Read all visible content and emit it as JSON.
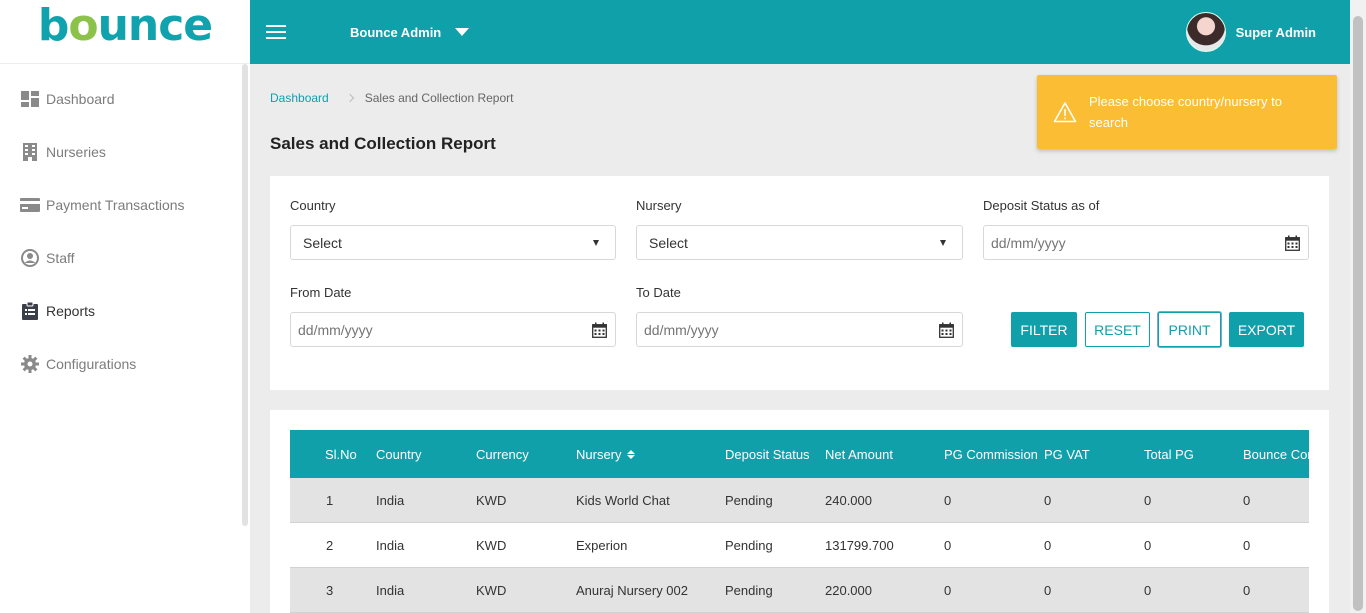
{
  "brand": {
    "logo_pre": "b",
    "logo_dot": "o",
    "logo_post": "unce",
    "primary_color": "#0fa0aa",
    "warning_color": "#fbbd33"
  },
  "sidebar": {
    "items": [
      {
        "label": "Dashboard",
        "icon": "dashboard-icon"
      },
      {
        "label": "Nurseries",
        "icon": "building-icon"
      },
      {
        "label": "Payment Transactions",
        "icon": "credit-card-icon"
      },
      {
        "label": "Staff",
        "icon": "user-icon"
      },
      {
        "label": "Reports",
        "icon": "clipboard-icon",
        "active": true
      },
      {
        "label": "Configurations",
        "icon": "gear-icon"
      }
    ]
  },
  "header": {
    "org_name": "Bounce Admin",
    "user_name": "Super Admin"
  },
  "breadcrumb": {
    "home": "Dashboard",
    "current": "Sales and Collection Report"
  },
  "page": {
    "title": "Sales and Collection Report"
  },
  "toast": {
    "message": "Please choose country/nursery to search",
    "line1": "Please choose country/nursery to",
    "line2": "search"
  },
  "filters": {
    "country": {
      "label": "Country",
      "value": "Select"
    },
    "nursery": {
      "label": "Nursery",
      "value": "Select"
    },
    "deposit_status_as_of": {
      "label": "Deposit Status as of",
      "placeholder": "dd/mm/yyyy"
    },
    "from_date": {
      "label": "From Date",
      "placeholder": "dd/mm/yyyy"
    },
    "to_date": {
      "label": "To Date",
      "placeholder": "dd/mm/yyyy"
    },
    "buttons": {
      "filter": "FILTER",
      "reset": "RESET",
      "print": "PRINT",
      "export": "EXPORT"
    }
  },
  "table": {
    "columns": [
      "Sl.No",
      "Country",
      "Currency",
      "Nursery",
      "Deposit Status",
      "Net Amount",
      "PG Commission",
      "PG VAT",
      "Total PG",
      "Bounce Com"
    ],
    "rows": [
      [
        "1",
        "India",
        "KWD",
        "Kids World Chat",
        "Pending",
        "240.000",
        "0",
        "0",
        "0",
        "0"
      ],
      [
        "2",
        "India",
        "KWD",
        "Experion",
        "Pending",
        "131799.700",
        "0",
        "0",
        "0",
        "0"
      ],
      [
        "3",
        "India",
        "KWD",
        "Anuraj Nursery 002",
        "Pending",
        "220.000",
        "0",
        "0",
        "0",
        "0"
      ]
    ]
  }
}
